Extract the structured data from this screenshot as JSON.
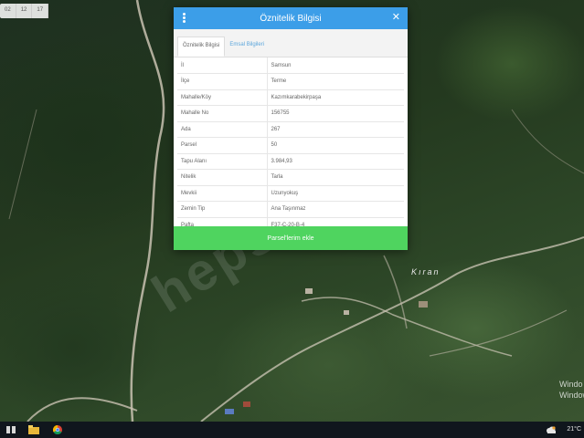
{
  "map": {
    "place_label": "Kıran",
    "watermark": "hepsi",
    "windows_note_line1": "Windo",
    "windows_note_line2": "Window",
    "toolbar_items": [
      "02",
      "12",
      "17"
    ]
  },
  "dialog": {
    "title": "Öznitelik Bilgisi",
    "tabs": [
      {
        "label": "Öznitelik Bilgisi",
        "active": true
      },
      {
        "label": "Emsal Bilgileri"
      }
    ],
    "rows": [
      {
        "key": "İl",
        "value": "Samsun"
      },
      {
        "key": "İlçe",
        "value": "Terme"
      },
      {
        "key": "Mahalle/Köy",
        "value": "Kazımkarabekirpaşa"
      },
      {
        "key": "Mahalle No",
        "value": "156755"
      },
      {
        "key": "Ada",
        "value": "267"
      },
      {
        "key": "Parsel",
        "value": "50"
      },
      {
        "key": "Tapu Alanı",
        "value": "3.984,93"
      },
      {
        "key": "Nitelik",
        "value": "Tarla"
      },
      {
        "key": "Mevkii",
        "value": "Uzunyokuş"
      },
      {
        "key": "Zemin Tip",
        "value": "Ana Taşınmaz"
      },
      {
        "key": "Pafta",
        "value": "F37-C-20-B-4"
      }
    ],
    "action_label": "Parsel'lerim ekle"
  },
  "taskbar": {
    "temperature": "21°C"
  },
  "colors": {
    "header_blue": "#3c9ee8",
    "action_green": "#4fd45f",
    "tab_link_blue": "#5ca6dc"
  }
}
